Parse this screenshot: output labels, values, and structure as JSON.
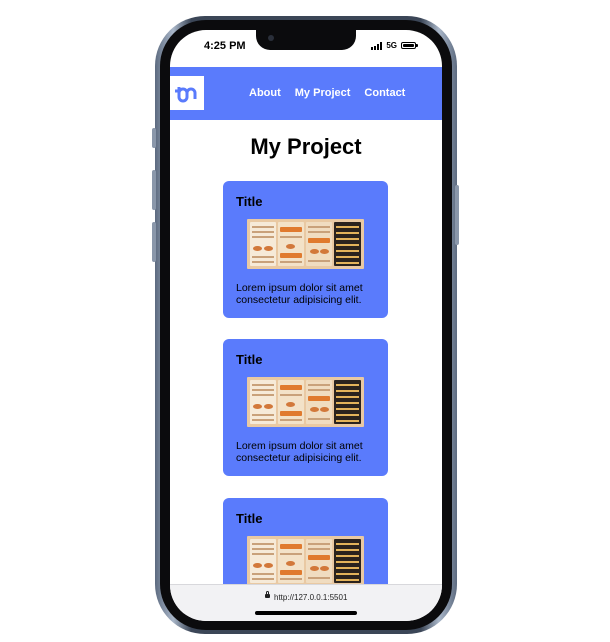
{
  "status_bar": {
    "time": "4:25 PM",
    "network": "5G"
  },
  "nav": {
    "logo_icon": "brand-logo-icon",
    "links": [
      "About",
      "My Project",
      "Contact"
    ]
  },
  "page": {
    "title": "My Project"
  },
  "cards": [
    {
      "title": "Title",
      "text": "Lorem ipsum dolor sit amet consectetur adipisicing elit."
    },
    {
      "title": "Title",
      "text": "Lorem ipsum dolor sit amet consectetur adipisicing elit."
    },
    {
      "title": "Title",
      "text": ""
    }
  ],
  "browser": {
    "url": "http://127.0.0.1:5501"
  },
  "colors": {
    "accent": "#5a7bfc",
    "frame": "#0b0b0d"
  }
}
